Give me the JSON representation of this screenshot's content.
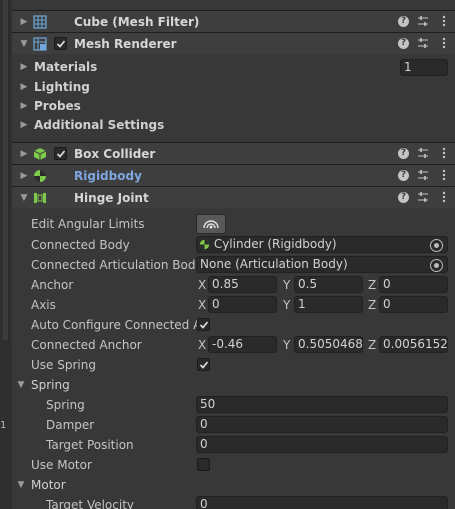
{
  "components": {
    "cube_mesh_filter": {
      "title": "Cube (Mesh Filter)"
    },
    "mesh_renderer": {
      "title": "Mesh Renderer",
      "enabled": true,
      "sections": {
        "materials": {
          "label": "Materials",
          "count": "1"
        },
        "lighting": "Lighting",
        "probes": "Probes",
        "additional_settings": "Additional Settings"
      }
    },
    "box_collider": {
      "title": "Box Collider",
      "enabled": true
    },
    "rigidbody": {
      "title": "Rigidbody"
    },
    "hinge_joint": {
      "title": "Hinge Joint",
      "edit_angular_limits": {
        "label": "Edit Angular Limits"
      },
      "connected_body": {
        "label": "Connected Body",
        "value": "Cylinder (Rigidbody)"
      },
      "connected_articulation_body": {
        "label": "Connected Articulation Body",
        "value": "None (Articulation Body)"
      },
      "anchor": {
        "label": "Anchor",
        "x": "0.85",
        "y": "0.5",
        "z": "0"
      },
      "axis": {
        "label": "Axis",
        "x": "0",
        "y": "1",
        "z": "0"
      },
      "auto_configure": {
        "label": "Auto Configure Connected Ar",
        "checked": true
      },
      "connected_anchor": {
        "label": "Connected Anchor",
        "x": "-0.46",
        "y": "0.5050468",
        "z": "0.0056152:"
      },
      "use_spring": {
        "label": "Use Spring",
        "checked": true
      },
      "spring_section": {
        "label": "Spring",
        "spring": {
          "label": "Spring",
          "value": "50"
        },
        "damper": {
          "label": "Damper",
          "value": "0"
        },
        "target_position": {
          "label": "Target Position",
          "value": "0"
        }
      },
      "use_motor": {
        "label": "Use Motor",
        "checked": false
      },
      "motor_section": {
        "label": "Motor",
        "target_velocity": {
          "label": "Target Velocity",
          "value": "0"
        }
      }
    }
  },
  "axis_letters": {
    "x": "X",
    "y": "Y",
    "z": "Z"
  },
  "left_strip_text": "1",
  "colors": {
    "header_bg": "#3e3e3e",
    "panel_bg": "#383838",
    "field_bg": "#2a2a2a",
    "link_blue": "#7ea7e0"
  },
  "icons": [
    "grid-icon",
    "mesh-renderer-icon",
    "box-collider-icon",
    "rigidbody-icon",
    "hinge-joint-icon",
    "help-icon",
    "presets-icon",
    "kebab-menu-icon",
    "object-picker-icon",
    "angular-limits-icon"
  ]
}
